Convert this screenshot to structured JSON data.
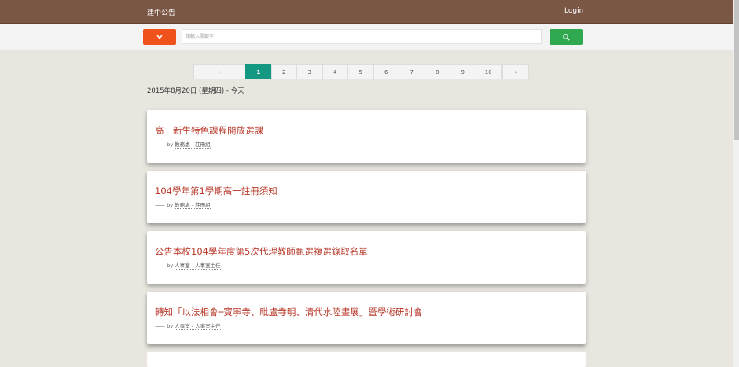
{
  "navbar": {
    "brand": "建中公告",
    "login": "Login"
  },
  "search": {
    "placeholder": "請輸入關鍵字"
  },
  "pager": {
    "prev": "‹",
    "pages": [
      "1",
      "2",
      "3",
      "4",
      "5",
      "6",
      "7",
      "8",
      "9",
      "10"
    ],
    "active": "1",
    "next": "›"
  },
  "date_header": {
    "date": "2015年8月20日 (星期四)",
    "separator": " - ",
    "today": "今天"
  },
  "posts": [
    {
      "title": "高一新生特色課程開放選課",
      "by": "—— by ",
      "dept": "教務處 - 註冊組"
    },
    {
      "title": "104學年第1學期高一註冊須知",
      "by": "—— by ",
      "dept": "教務處 - 註冊組"
    },
    {
      "title": "公告本校104學年度第5次代理教師甄選複選錄取名單",
      "by": "—— by ",
      "dept": "人事室 - 人事室主任"
    },
    {
      "title": "轉知「以法相會─寶寧寺、毗盧寺明、清代水陸畫展」暨學術研討會",
      "by": "—— by ",
      "dept": "人事室 - 人事室主任"
    }
  ],
  "colors": {
    "navbar": "#7a5645",
    "dropdown_button": "#f0521c",
    "search_button": "#2fa84f",
    "active_page": "#159882",
    "post_title": "#b83a2b"
  },
  "icons": {
    "dropdown": "chevron-down-icon",
    "search": "search-icon"
  }
}
